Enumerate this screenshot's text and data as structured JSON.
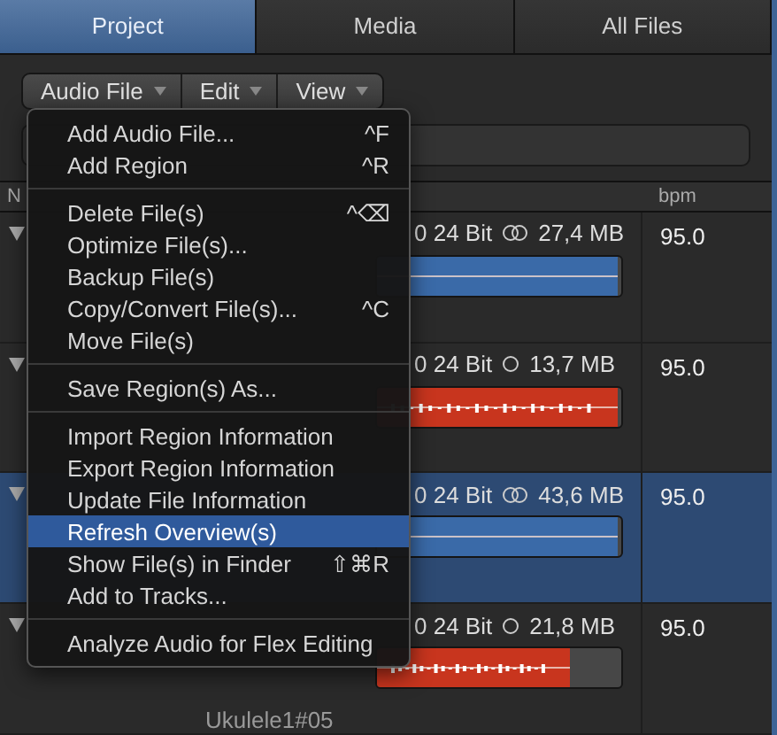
{
  "tabs": [
    {
      "label": "Project",
      "selected": true
    },
    {
      "label": "Media",
      "selected": false
    },
    {
      "label": "All Files",
      "selected": false
    }
  ],
  "toolbar": [
    "Audio File",
    "Edit",
    "View"
  ],
  "table": {
    "columns": [
      "N",
      "bpm"
    ],
    "rows": [
      {
        "expanded": true,
        "selected": false,
        "format": "0 24 Bit",
        "kind": "stereo",
        "size": "27,4 MB",
        "bpm": "95.0",
        "color": "#3a6aa8",
        "level": 1
      },
      {
        "expanded": true,
        "selected": false,
        "format": "0 24 Bit",
        "kind": "mono",
        "size": "13,7 MB",
        "bpm": "95.0",
        "color": "#c8351e",
        "level": 1
      },
      {
        "expanded": true,
        "selected": true,
        "format": "0 24 Bit",
        "kind": "stereo",
        "size": "43,6 MB",
        "bpm": "95.0",
        "color": "#3a6aa8",
        "level": 1
      },
      {
        "expanded": true,
        "selected": false,
        "format": "0 24 Bit",
        "kind": "mono",
        "size": "21,8 MB",
        "bpm": "95.0",
        "color": "#c8351e",
        "level": 0.8,
        "name": "Ukulele1#05"
      }
    ]
  },
  "menu": {
    "groups": [
      [
        {
          "label": "Add Audio File...",
          "shortcut": "^F",
          "highlighted": false
        },
        {
          "label": "Add Region",
          "shortcut": "^R",
          "highlighted": false
        }
      ],
      [
        {
          "label": "Delete File(s)",
          "shortcut": "^⌫",
          "highlighted": false
        },
        {
          "label": "Optimize File(s)...",
          "highlighted": false
        },
        {
          "label": "Backup File(s)",
          "highlighted": false
        },
        {
          "label": "Copy/Convert File(s)...",
          "shortcut": "^C",
          "highlighted": false
        },
        {
          "label": "Move File(s)",
          "highlighted": false
        }
      ],
      [
        {
          "label": "Save Region(s) As...",
          "highlighted": false
        }
      ],
      [
        {
          "label": "Import Region Information",
          "highlighted": false
        },
        {
          "label": "Export Region Information",
          "highlighted": false
        },
        {
          "label": "Update File Information",
          "highlighted": false
        },
        {
          "label": "Refresh Overview(s)",
          "highlighted": true
        },
        {
          "label": "Show File(s) in Finder",
          "shortcut": "⇧⌘R",
          "highlighted": false
        },
        {
          "label": "Add to Tracks...",
          "highlighted": false
        }
      ],
      [
        {
          "label": "Analyze Audio for Flex Editing",
          "highlighted": false
        }
      ]
    ]
  }
}
